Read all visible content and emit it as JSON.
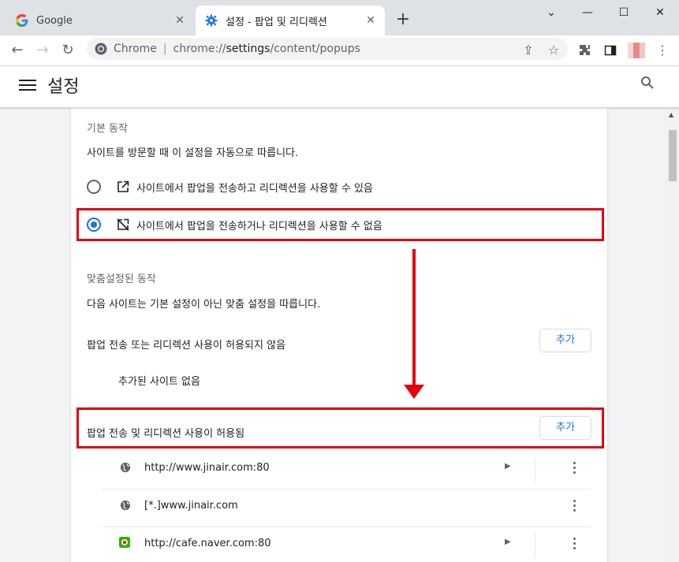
{
  "tabs": [
    {
      "title": "Google",
      "active": false
    },
    {
      "title": "설정 - 팝업 및 리디렉션",
      "active": true
    }
  ],
  "toolbar": {
    "site_label": "Chrome",
    "url_prefix": "chrome://",
    "url_bold": "settings",
    "url_rest": "/content/popups"
  },
  "header": {
    "title": "설정"
  },
  "default_section": {
    "heading": "기본 동작",
    "description": "사이트를 방문할 때 이 설정을 자동으로 따릅니다.",
    "options": [
      {
        "label": "사이트에서 팝업을 전송하고 리디렉션을 사용할 수 있음",
        "selected": false
      },
      {
        "label": "사이트에서 팝업을 전송하거나 리디렉션을 사용할 수 없음",
        "selected": true
      }
    ]
  },
  "custom_section": {
    "heading": "맞춤설정된 동작",
    "description": "다음 사이트는 기본 설정이 아닌 맞춤 설정을 따릅니다.",
    "blocked": {
      "title": "팝업 전송 또는 리디렉션 사용이 허용되지 않음",
      "add_label": "추가",
      "empty_text": "추가된 사이트 없음"
    },
    "allowed": {
      "title": "팝업 전송 및 리디렉션 사용이 허용됨",
      "add_label": "추가",
      "sites": [
        {
          "url": "http://www.jinair.com:80",
          "icon": "globe-icon",
          "has_arrow": true
        },
        {
          "url": "[*.]www.jinair.com",
          "icon": "globe-icon",
          "has_arrow": false
        },
        {
          "url": "http://cafe.naver.com:80",
          "icon": "naver-cafe-icon",
          "has_arrow": true
        }
      ]
    }
  },
  "colors": {
    "accent": "#1a73e8",
    "annotation": "#e3000f"
  }
}
